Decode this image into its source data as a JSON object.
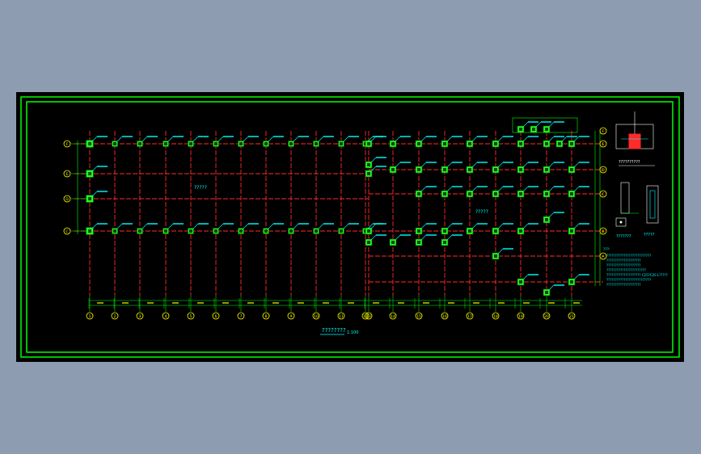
{
  "drawing": {
    "title": "????????",
    "title_scale": "1:100",
    "plan_left_label": "?????",
    "plan_right_label": "?????",
    "detail_section_label": "??????????",
    "detail_legend_label": "???????",
    "detail_sub_label": "?????",
    "notes_heading": "???:",
    "notes": [
      "??????????????????????????",
      "????????????????????",
      "????????????????????",
      "???????????????????????",
      "???????????????????? C25?C20 L?????",
      "??????????????????????????",
      "????????????????????"
    ],
    "bottom_axis_labels": [
      "1",
      "2",
      "3",
      "4",
      "5",
      "6",
      "7",
      "8",
      "9",
      "10",
      "11",
      "12",
      "13",
      "14",
      "15",
      "16",
      "17",
      "18",
      "19",
      "20",
      "21"
    ],
    "left_axis_labels": [
      "F",
      "E",
      "D",
      "C"
    ],
    "right_axis_labels": [
      "F",
      "E",
      "D",
      "C",
      "B",
      "A"
    ]
  },
  "colors": {
    "background": "#8e9cb2",
    "paper": "#000000",
    "frame": "#00ff00",
    "grid": "#ff2a2a",
    "column": "#22ff22",
    "label": "#00ffff",
    "dim": "#ffff00"
  }
}
